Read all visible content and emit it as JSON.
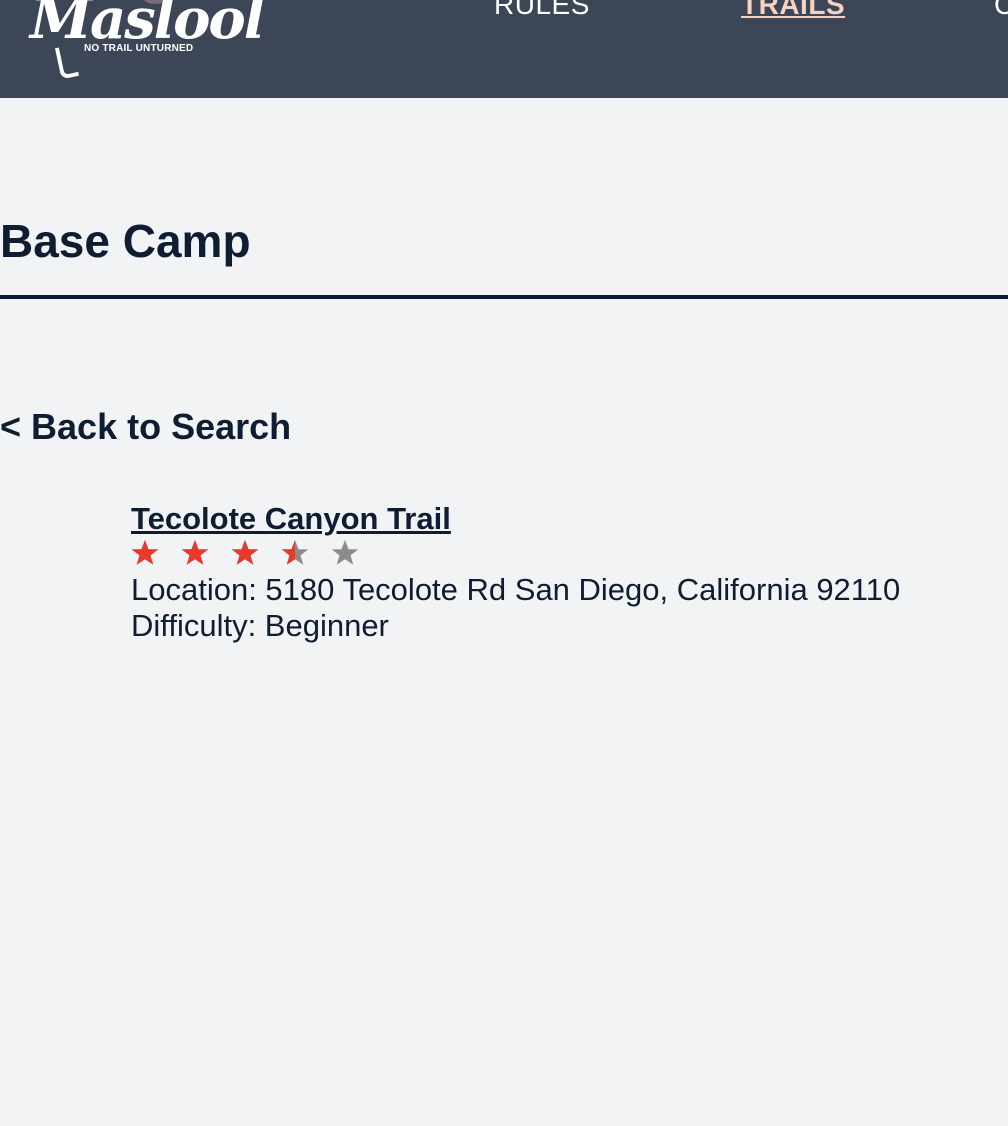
{
  "header": {
    "logo": {
      "script_text": "Maslool",
      "tagline": "NO TRAIL UNTURNED"
    },
    "nav": [
      {
        "label": "RULES",
        "active": false
      },
      {
        "label": "TRAILS",
        "active": true
      },
      {
        "label": "C",
        "active": false
      }
    ],
    "colors": {
      "background": "#3c4656",
      "active_link": "#f7d2c2"
    }
  },
  "main": {
    "title": "Base Camp",
    "back_link": "< Back to Search",
    "trail": {
      "name": "Tecolote Canyon Trail",
      "rating": 3.5,
      "rating_max": 5,
      "location_label": "Location:",
      "location_value": "5180 Tecolote Rd San Diego, California 92110",
      "location_line": "Location: 5180 Tecolote Rd San Diego, California 92110",
      "difficulty_line": "Difficulty: Beginner"
    },
    "colors": {
      "star_filled": "#e8392a",
      "star_empty": "#8c8c8c",
      "text": "#0f1d33",
      "page_background": "#f2f3f5"
    },
    "icons": {
      "star": "star-icon"
    }
  }
}
